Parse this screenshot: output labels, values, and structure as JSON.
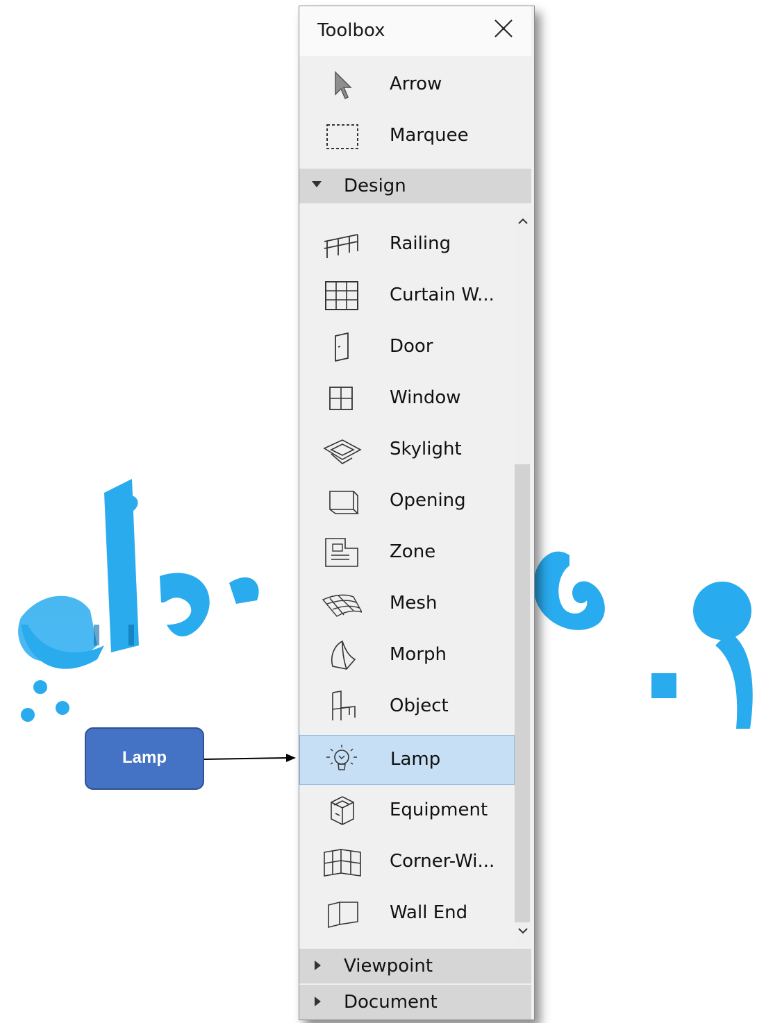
{
  "toolbox": {
    "title": "Toolbox",
    "top_tools": [
      {
        "label": "Arrow",
        "icon": "arrow-pointer-icon"
      },
      {
        "label": "Marquee",
        "icon": "marquee-icon"
      }
    ],
    "design_section": {
      "label": "Design",
      "expanded": true
    },
    "design_tools": [
      {
        "label": "Railing",
        "icon": "railing-icon"
      },
      {
        "label": "Curtain W...",
        "icon": "curtain-wall-icon"
      },
      {
        "label": "Door",
        "icon": "door-icon"
      },
      {
        "label": "Window",
        "icon": "window-icon"
      },
      {
        "label": "Skylight",
        "icon": "skylight-icon"
      },
      {
        "label": "Opening",
        "icon": "opening-icon"
      },
      {
        "label": "Zone",
        "icon": "zone-icon"
      },
      {
        "label": "Mesh",
        "icon": "mesh-icon"
      },
      {
        "label": "Morph",
        "icon": "morph-icon"
      },
      {
        "label": "Object",
        "icon": "object-chair-icon"
      },
      {
        "label": "Lamp",
        "icon": "lamp-icon",
        "selected": true
      },
      {
        "label": "Equipment",
        "icon": "equipment-icon"
      },
      {
        "label": "Corner-Wi...",
        "icon": "corner-window-icon"
      },
      {
        "label": "Wall End",
        "icon": "wall-end-icon"
      }
    ],
    "collapsed_sections": [
      {
        "label": "Viewpoint"
      },
      {
        "label": "Document"
      }
    ]
  },
  "callout": {
    "label": "Lamp",
    "color": "#4472c4"
  },
  "watermark": {
    "text": "م. هبة علي",
    "color": "#29b6f6"
  }
}
